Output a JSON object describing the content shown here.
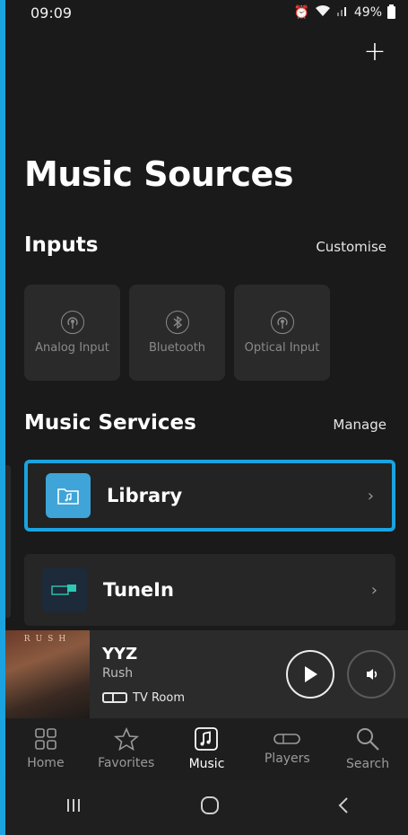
{
  "status_bar": {
    "time": "09:09",
    "battery": "49%"
  },
  "page": {
    "title": "Music Sources"
  },
  "inputs": {
    "heading": "Inputs",
    "action": "Customise",
    "items": [
      {
        "label": "Analog Input",
        "icon": "antenna-icon"
      },
      {
        "label": "Bluetooth",
        "icon": "bluetooth-icon"
      },
      {
        "label": "Optical Input",
        "icon": "antenna-icon"
      }
    ]
  },
  "services": {
    "heading": "Music Services",
    "action": "Manage",
    "items": [
      {
        "name": "Library",
        "icon": "music-folder-icon",
        "color": "#3fa4d8"
      },
      {
        "name": "TuneIn",
        "icon": "tunein-logo",
        "color": "#1c2a3a"
      }
    ]
  },
  "now_playing": {
    "title": "YYZ",
    "artist": "Rush",
    "room": "TV Room",
    "album_text": "RUSH"
  },
  "tabs": [
    {
      "label": "Home",
      "icon": "home-grid-icon"
    },
    {
      "label": "Favorites",
      "icon": "star-icon"
    },
    {
      "label": "Music",
      "icon": "music-note-icon",
      "active": true
    },
    {
      "label": "Players",
      "icon": "speaker-icon"
    },
    {
      "label": "Search",
      "icon": "search-icon"
    }
  ],
  "colors": {
    "accent": "#1aa3e0",
    "background": "#1a1a1a",
    "tile": "#2a2a2a"
  }
}
